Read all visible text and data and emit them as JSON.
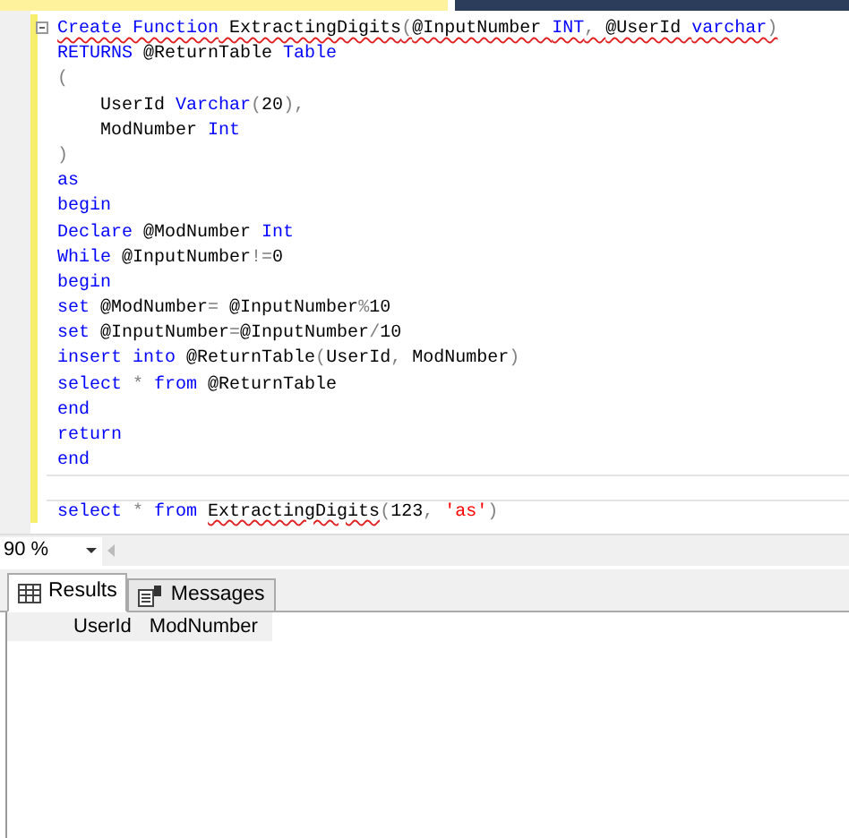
{
  "editor": {
    "lines": [
      {
        "blank_before": false,
        "tokens": [
          {
            "text": "Create ",
            "kind": "kw",
            "squiggle": true
          },
          {
            "text": "Function",
            "kind": "kw",
            "squiggle": true
          },
          {
            "text": " ExtractingDigits",
            "kind": "plain",
            "squiggle": true
          },
          {
            "text": "(",
            "kind": "op",
            "squiggle": true
          },
          {
            "text": "@InputNumber ",
            "kind": "plain",
            "squiggle": true
          },
          {
            "text": "INT",
            "kind": "kw",
            "squiggle": true
          },
          {
            "text": ", ",
            "kind": "op",
            "squiggle": true
          },
          {
            "text": "@UserId ",
            "kind": "plain",
            "squiggle": true
          },
          {
            "text": "varchar",
            "kind": "kw",
            "squiggle": true
          },
          {
            "text": ")",
            "kind": "op",
            "squiggle": true
          }
        ]
      },
      {
        "blank_before": false,
        "tokens": [
          {
            "text": "RETURNS",
            "kind": "kw",
            "squiggle": false
          },
          {
            "text": " @ReturnTable ",
            "kind": "plain",
            "squiggle": false
          },
          {
            "text": "Table",
            "kind": "kw",
            "squiggle": false
          }
        ]
      },
      {
        "blank_before": false,
        "tokens": [
          {
            "text": "(",
            "kind": "op",
            "squiggle": false
          }
        ]
      },
      {
        "blank_before": false,
        "tokens": [
          {
            "text": "    UserId ",
            "kind": "plain",
            "squiggle": false
          },
          {
            "text": "Varchar",
            "kind": "kw",
            "squiggle": false
          },
          {
            "text": "(",
            "kind": "op",
            "squiggle": false
          },
          {
            "text": "20",
            "kind": "plain",
            "squiggle": false
          },
          {
            "text": "),",
            "kind": "op",
            "squiggle": false
          }
        ]
      },
      {
        "blank_before": false,
        "tokens": [
          {
            "text": "    ModNumber ",
            "kind": "plain",
            "squiggle": false
          },
          {
            "text": "Int",
            "kind": "kw",
            "squiggle": false
          }
        ]
      },
      {
        "blank_before": false,
        "tokens": [
          {
            "text": ")",
            "kind": "op",
            "squiggle": false
          }
        ]
      },
      {
        "blank_before": false,
        "tokens": [
          {
            "text": "as",
            "kind": "kw",
            "squiggle": false
          }
        ]
      },
      {
        "blank_before": false,
        "tokens": [
          {
            "text": "begin",
            "kind": "kw",
            "squiggle": false
          }
        ]
      },
      {
        "blank_before": false,
        "tokens": [
          {
            "text": "Declare",
            "kind": "kw",
            "squiggle": false
          },
          {
            "text": " @ModNumber ",
            "kind": "plain",
            "squiggle": false
          },
          {
            "text": "Int",
            "kind": "kw",
            "squiggle": false
          }
        ]
      },
      {
        "blank_before": false,
        "tokens": [
          {
            "text": "While",
            "kind": "kw",
            "squiggle": false
          },
          {
            "text": " @InputNumber",
            "kind": "plain",
            "squiggle": false
          },
          {
            "text": "!=",
            "kind": "op",
            "squiggle": false
          },
          {
            "text": "0",
            "kind": "plain",
            "squiggle": false
          }
        ]
      },
      {
        "blank_before": false,
        "tokens": [
          {
            "text": "begin",
            "kind": "kw",
            "squiggle": false
          }
        ]
      },
      {
        "blank_before": false,
        "tokens": [
          {
            "text": "set",
            "kind": "kw",
            "squiggle": false
          },
          {
            "text": " @ModNumber",
            "kind": "plain",
            "squiggle": false
          },
          {
            "text": "=",
            "kind": "op",
            "squiggle": false
          },
          {
            "text": " @InputNumber",
            "kind": "plain",
            "squiggle": false
          },
          {
            "text": "%",
            "kind": "op",
            "squiggle": false
          },
          {
            "text": "10",
            "kind": "plain",
            "squiggle": false
          }
        ]
      },
      {
        "blank_before": false,
        "tokens": [
          {
            "text": "set",
            "kind": "kw",
            "squiggle": false
          },
          {
            "text": " @InputNumber",
            "kind": "plain",
            "squiggle": false
          },
          {
            "text": "=",
            "kind": "op",
            "squiggle": false
          },
          {
            "text": "@InputNumber",
            "kind": "plain",
            "squiggle": false
          },
          {
            "text": "/",
            "kind": "op",
            "squiggle": false
          },
          {
            "text": "10",
            "kind": "plain",
            "squiggle": false
          }
        ]
      },
      {
        "blank_before": false,
        "tokens": [
          {
            "text": "insert ",
            "kind": "kw",
            "squiggle": false
          },
          {
            "text": "into",
            "kind": "kw",
            "squiggle": false
          },
          {
            "text": " @ReturnTable",
            "kind": "plain",
            "squiggle": false
          },
          {
            "text": "(",
            "kind": "op",
            "squiggle": false
          },
          {
            "text": "UserId",
            "kind": "plain",
            "squiggle": false
          },
          {
            "text": ", ",
            "kind": "op",
            "squiggle": false
          },
          {
            "text": "ModNumber",
            "kind": "plain",
            "squiggle": false
          },
          {
            "text": ")",
            "kind": "op",
            "squiggle": false
          }
        ]
      },
      {
        "blank_before": false,
        "tokens": [
          {
            "text": "select",
            "kind": "kw",
            "squiggle": false
          },
          {
            "text": " * ",
            "kind": "op",
            "squiggle": false
          },
          {
            "text": "from",
            "kind": "kw",
            "squiggle": false
          },
          {
            "text": " @ReturnTable",
            "kind": "plain",
            "squiggle": false
          }
        ]
      },
      {
        "blank_before": false,
        "tokens": [
          {
            "text": "end",
            "kind": "kw",
            "squiggle": false
          }
        ]
      },
      {
        "blank_before": false,
        "tokens": [
          {
            "text": "return",
            "kind": "kw",
            "squiggle": false
          }
        ]
      },
      {
        "blank_before": false,
        "tokens": [
          {
            "text": "end",
            "kind": "kw",
            "squiggle": false
          }
        ]
      },
      {
        "blank_before": true,
        "tokens": [
          {
            "text": "select",
            "kind": "kw",
            "squiggle": false
          },
          {
            "text": " * ",
            "kind": "op",
            "squiggle": false
          },
          {
            "text": "from ",
            "kind": "kw",
            "squiggle": false
          },
          {
            "text": "ExtractingDigits",
            "kind": "plain",
            "squiggle": true
          },
          {
            "text": "(",
            "kind": "op",
            "squiggle": false
          },
          {
            "text": "123",
            "kind": "plain",
            "squiggle": false
          },
          {
            "text": ", ",
            "kind": "op",
            "squiggle": false
          },
          {
            "text": "'as'",
            "kind": "str",
            "squiggle": false
          },
          {
            "text": ")",
            "kind": "op",
            "squiggle": false
          }
        ]
      }
    ]
  },
  "zoom": {
    "value": "90 %"
  },
  "result_tabs": [
    {
      "label": "Results",
      "selected": true,
      "kind": "grid"
    },
    {
      "label": "Messages",
      "selected": false,
      "kind": "messages"
    }
  ],
  "results": {
    "columns": [
      "UserId",
      "ModNumber"
    ]
  }
}
